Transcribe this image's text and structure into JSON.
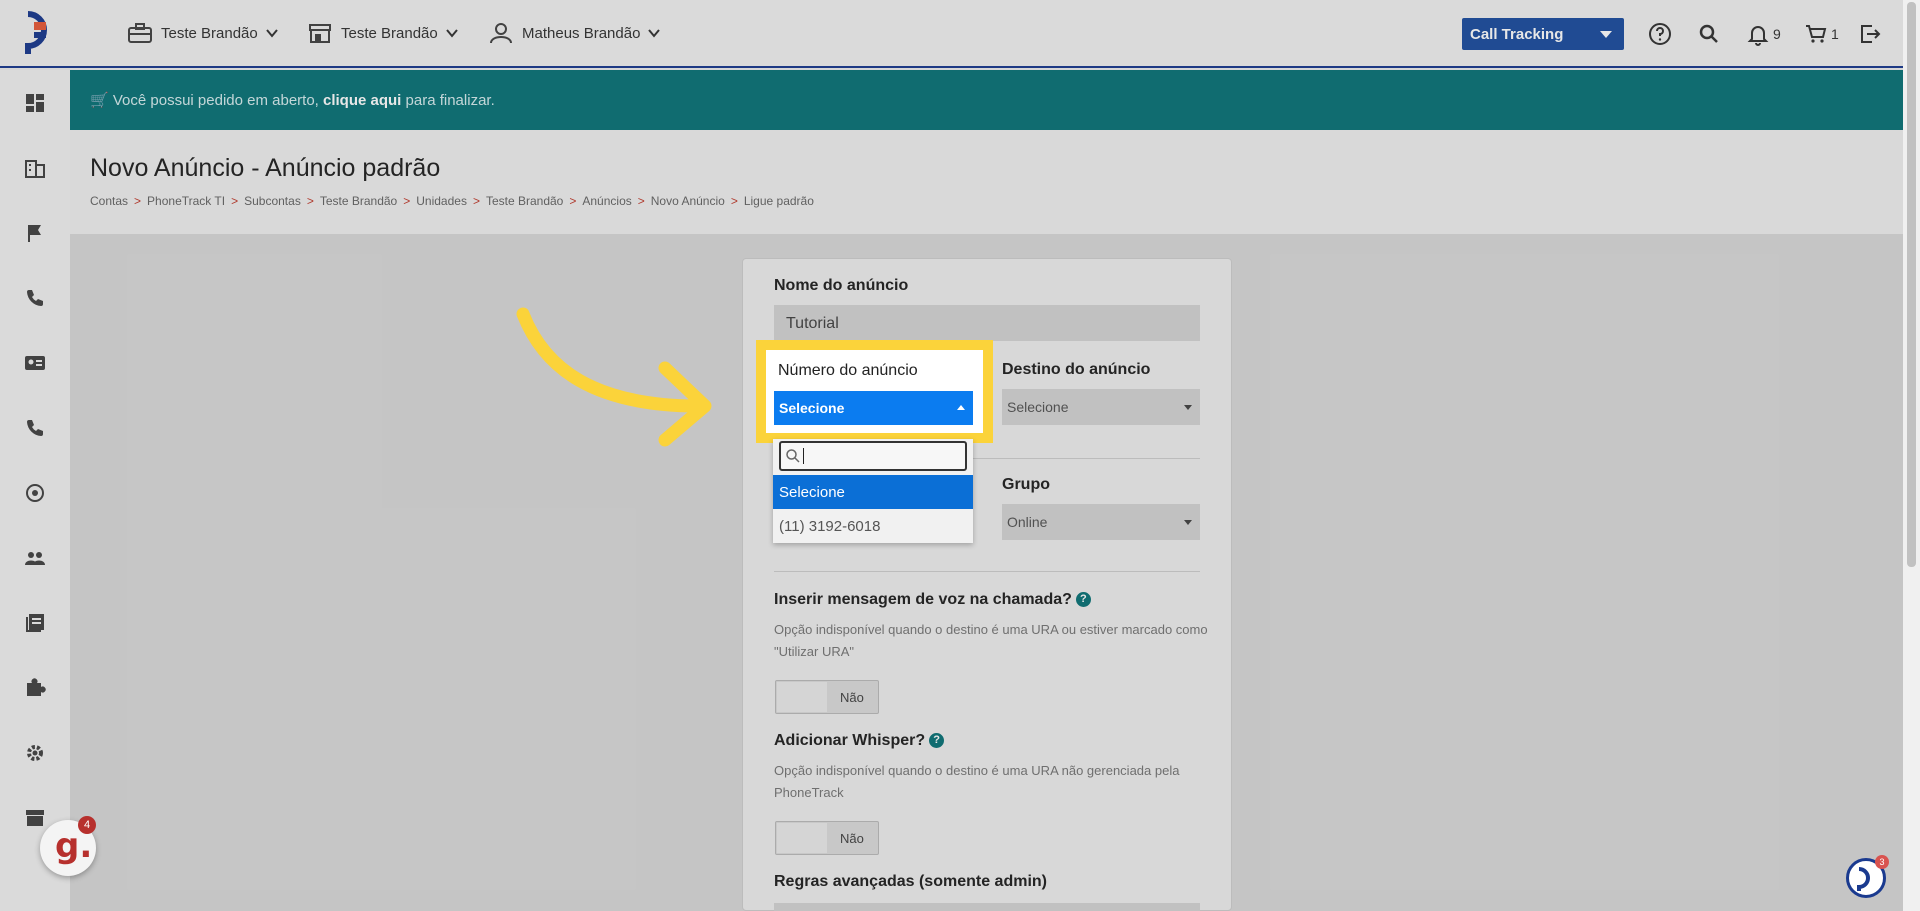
{
  "topbar": {
    "menus": [
      {
        "label": "Teste Brandão",
        "icon": "briefcase-icon"
      },
      {
        "label": "Teste Brandão",
        "icon": "store-icon"
      },
      {
        "label": "Matheus Brandão",
        "icon": "user-icon"
      }
    ],
    "product_select": "Call Tracking",
    "notifications_count": "9",
    "cart_count": "1"
  },
  "sidebar": {
    "items": [
      "dashboard-icon",
      "building-icon",
      "flag-icon",
      "phone-icon",
      "contact-card-icon",
      "phone-icon",
      "headset-icon",
      "people-icon",
      "book-icon",
      "puzzle-icon",
      "gear-icon",
      "store-icon"
    ]
  },
  "banner": {
    "prefix": "Você possui pedido em aberto, ",
    "link": "clique aqui",
    "suffix": " para finalizar."
  },
  "page": {
    "title": "Novo Anúncio - Anúncio padrão",
    "breadcrumb": [
      "Contas",
      "PhoneTrack TI",
      "Subcontas",
      "Teste Brandão",
      "Unidades",
      "Teste Brandão",
      "Anúncios",
      "Novo Anúncio",
      "Ligue padrão"
    ]
  },
  "form": {
    "name_label": "Nome do anúncio",
    "name_value": "Tutorial",
    "number_label": "Número do anúncio",
    "number_value": "Selecione",
    "destination_label": "Destino do anúncio",
    "destination_value": "Selecione",
    "group_label": "Grupo",
    "group_value": "Online",
    "voice_label": "Inserir mensagem de voz na chamada?",
    "voice_help": "Opção indisponível quando o destino é uma URA ou estiver marcado como \"Utilizar URA\"",
    "voice_toggle": "Não",
    "whisper_label": "Adicionar Whisper?",
    "whisper_help": "Opção indisponível quando o destino é uma URA não gerenciada pela PhoneTrack",
    "whisper_toggle": "Não",
    "advanced_label": "Regras avançadas (somente admin)"
  },
  "dropdown": {
    "options": [
      "Selecione",
      "(11) 3192-6018"
    ],
    "selected": "Selecione"
  },
  "widgets": {
    "g_badge": "4",
    "p_badge": "3"
  },
  "colors": {
    "brand": "#1a3a8f",
    "banner": "#0b7478",
    "highlight": "#fbd33a",
    "select_active": "#0b7cf0"
  }
}
